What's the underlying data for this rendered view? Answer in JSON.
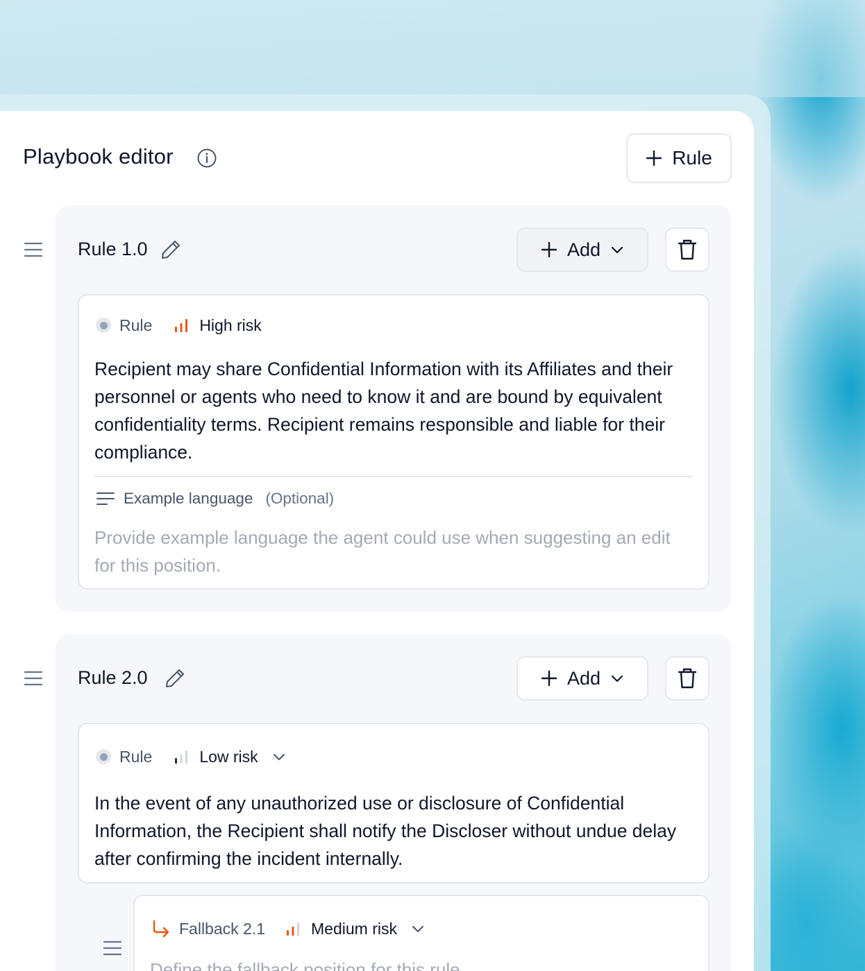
{
  "header": {
    "title": "Playbook editor",
    "add_rule_label": "Rule"
  },
  "rules": [
    {
      "title": "Rule 1.0",
      "add_label": "Add",
      "kind": "Rule",
      "risk": "High risk",
      "risk_level": 3,
      "text": "Recipient may share Confidential Information with its Affiliates and their personnel or agents who need to know it and are bound by equivalent confidentiality terms. Recipient remains responsible and liable for their compliance.",
      "example_label": "Example language",
      "example_optional": "(Optional)",
      "example_placeholder": "Provide example language the agent could use when suggesting an edit for this position."
    },
    {
      "title": "Rule 2.0",
      "add_label": "Add",
      "kind": "Rule",
      "risk": "Low risk",
      "risk_level": 1,
      "text": "In the event of any unauthorized use or disclosure of Confidential Information, the Recipient shall notify the Discloser without undue delay after confirming the incident internally.",
      "fallback": {
        "kind": "Fallback 2.1",
        "risk": "Medium risk",
        "risk_level": 2,
        "placeholder": "Define the fallback position for this rule"
      }
    }
  ],
  "colors": {
    "risk_high": "#ea580c",
    "risk_inactive": "#d1d5db",
    "text_primary": "#0f172a",
    "placeholder": "#a3aab5"
  }
}
